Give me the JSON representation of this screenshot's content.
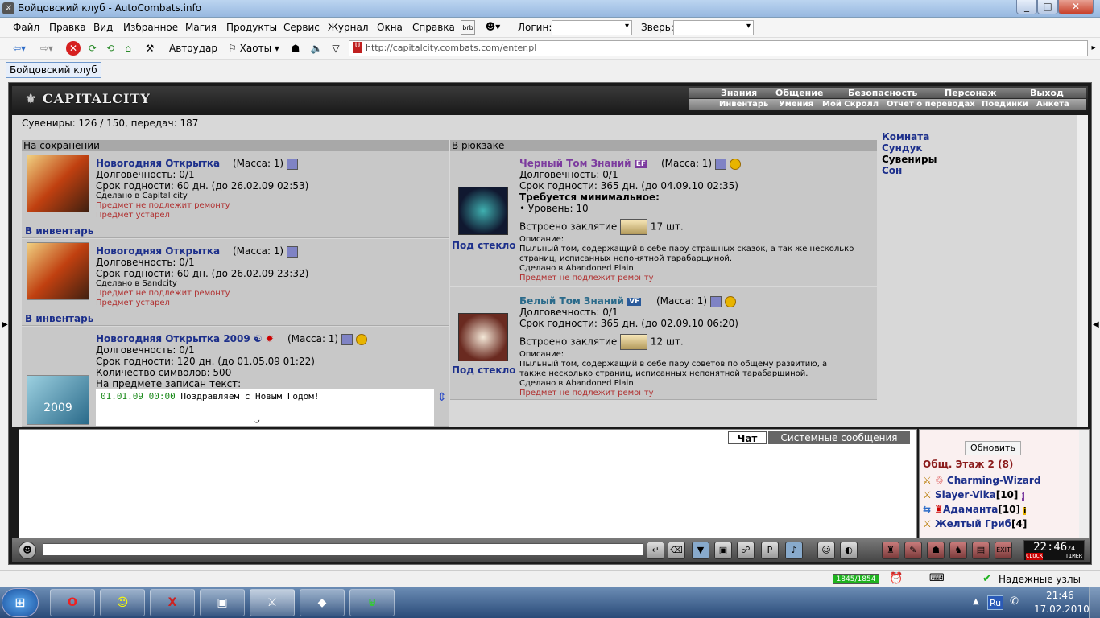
{
  "window": {
    "title": "Бойцовский клуб - AutoCombats.info",
    "min": "_",
    "max": "□",
    "close": "✕"
  },
  "menu": {
    "items": [
      "Файл",
      "Правка",
      "Вид",
      "Избранное",
      "Магия",
      "Продукты",
      "Сервис",
      "Журнал",
      "Окна",
      "Справка"
    ],
    "login_label": "Логин:",
    "beast_label": "Зверь:",
    "login_value": "",
    "beast_value": ""
  },
  "toolbar": {
    "autohit": "Автоудар",
    "chaos": "Хаоты",
    "url": "http://capitalcity.combats.com/enter.pl"
  },
  "tabs": [
    {
      "label": "Бойцовский клуб"
    }
  ],
  "game": {
    "logo": "CAPITALCITY",
    "nav_top": [
      "Знания",
      "Общение",
      "Безопасность",
      "Персонаж",
      "Выход"
    ],
    "nav_bottom": [
      "Инвентарь",
      "Умения",
      "Мой Скролл",
      "Отчет о переводах",
      "Поединки",
      "Анкета"
    ],
    "souvenirs": "Сувениры: 126 / 150, передач: 187",
    "sect_saved": "На сохранении",
    "sect_backpack": "В рюкзаке",
    "right_nav": [
      "Комната",
      "Сундук",
      "Сувениры",
      "Сон"
    ],
    "saved": [
      {
        "name": "Новогодняя Открытка",
        "mass": "(Масса: 1)",
        "durability": "Долговечность: 0/1",
        "expiry": "Срок годности: 60 дн. (до 26.02.09 02:53)",
        "made": "Сделано в Capital city",
        "warn1": "Предмет не подлежит ремонту",
        "warn2": "Предмет устарел",
        "action": "В инвентарь"
      },
      {
        "name": "Новогодняя Открытка",
        "mass": "(Масса: 1)",
        "durability": "Долговечность: 0/1",
        "expiry": "Срок годности: 60 дн. (до 26.02.09 23:32)",
        "made": "Сделано в Sandcity",
        "warn1": "Предмет не подлежит ремонту",
        "warn2": "Предмет устарел",
        "action": "В инвентарь"
      },
      {
        "name": "Новогодняя Открытка 2009",
        "mass": "(Масса: 1)",
        "durability": "Долговечность: 0/1",
        "expiry": "Срок годности: 120 дн. (до 01.05.09 01:22)",
        "symbols": "Количество символов: 500",
        "written": "На предмете записан текст:",
        "msg_time": "01.01.09 00:00",
        "msg_text": "Поздравляем с Новым Годом!",
        "pic_text": "2009"
      }
    ],
    "backpack": [
      {
        "name": "Черный Том Знаний",
        "badge": "EF",
        "mass": "(Масса: 1)",
        "durability": "Долговечность: 0/1",
        "expiry": "Срок годности: 365 дн. (до 04.09.10 02:35)",
        "req": "Требуется минимальное:",
        "level": "• Уровень: 10",
        "spell": "Встроено заклятие",
        "spell_count": "17 шт.",
        "desc_label": "Описание:",
        "desc": "Пыльный том, содержащий в себе пару страшных сказок, а так же несколько",
        "desc2": "страниц, исписанных непонятной тарабарщиной.",
        "made": "Сделано в Abandoned Plain",
        "warn": "Предмет не подлежит ремонту",
        "action": "Под стекло"
      },
      {
        "name": "Белый Том Знаний",
        "badge": "VF",
        "mass": "(Масса: 1)",
        "durability": "Долговечность: 0/1",
        "expiry": "Срок годности: 365 дн. (до 02.09.10 06:20)",
        "spell": "Встроено заклятие",
        "spell_count": "12 шт.",
        "desc_label": "Описание:",
        "desc": "Пыльный том, содержащий в себе пару советов по общему развитию, а",
        "desc2": "также несколько страниц, исписанных непонятной тарабарщиной.",
        "made": "Сделано в Abandoned Plain",
        "warn": "Предмет не подлежит ремонту",
        "action": "Под стекло"
      }
    ],
    "chat_tabs": [
      "Чат",
      "Системные сообщения"
    ],
    "refresh": "Обновить",
    "room": "Общ. Этаж 2 (8)",
    "users": [
      {
        "name": "Charming-Wizard",
        "level": ""
      },
      {
        "name": "Slayer-Vika",
        "level": "[10]"
      },
      {
        "name": "Адаманта",
        "level": "[10]"
      },
      {
        "name": "Желтый Гриб",
        "level": "[4]"
      }
    ],
    "clock": "22:46",
    "clock_sec": "24",
    "clock_l": "CLOCK",
    "clock_r": "TIMER"
  },
  "status": {
    "counter": "1845/1854",
    "trusted": "Надежные узлы"
  },
  "taskbar": {
    "lang": "Ru",
    "time": "21:46",
    "date": "17.02.2010"
  },
  "colors": {
    "link": "#1c2f8b",
    "warn": "#b03030",
    "purple": "#7c3b9e"
  }
}
